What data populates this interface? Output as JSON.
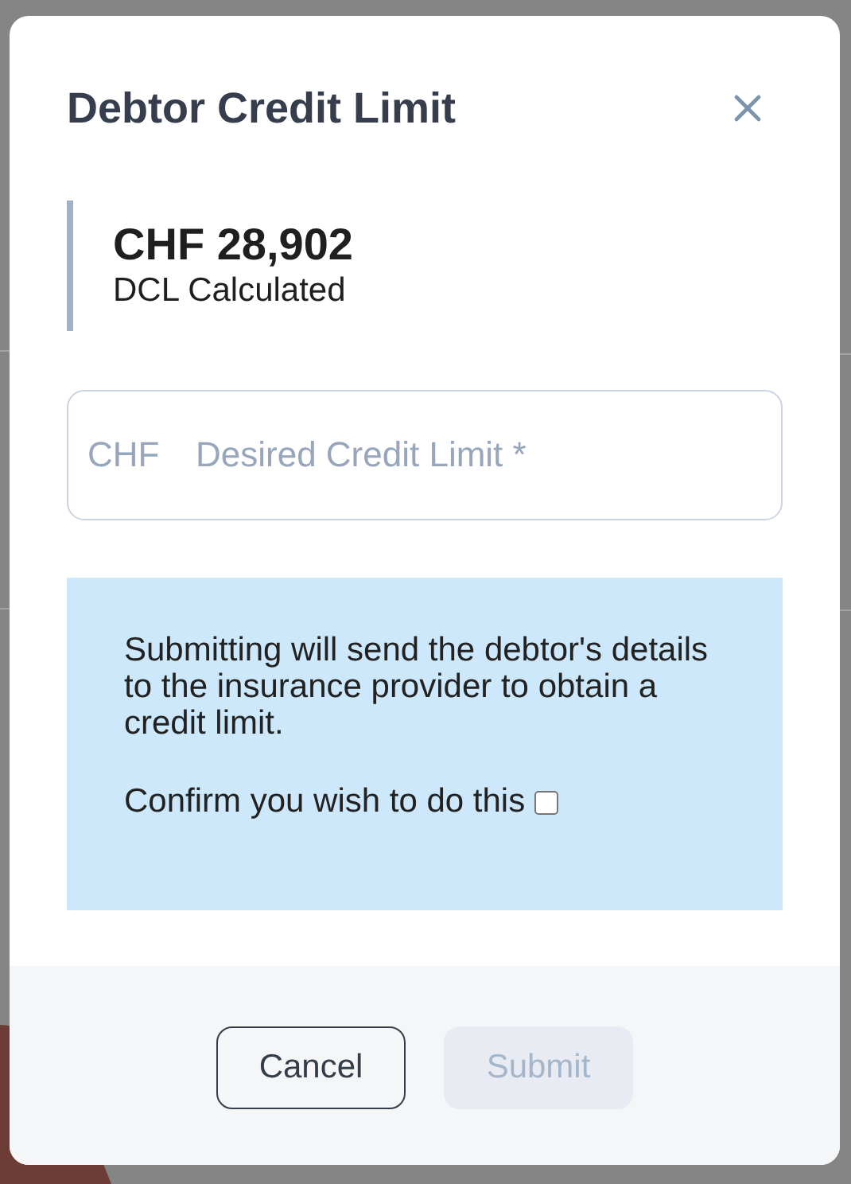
{
  "dialog": {
    "title": "Debtor Credit Limit"
  },
  "stat": {
    "value": "CHF 28,902",
    "label": "DCL Calculated"
  },
  "field": {
    "prefix": "CHF",
    "placeholder": "Desired Credit Limit *"
  },
  "notice": {
    "message": "Submitting will send the debtor's details to the insurance provider to obtain a credit limit.",
    "confirm_label": "Confirm you wish to do this",
    "checked": false
  },
  "buttons": [
    {
      "label": "Cancel",
      "kind": "secondary",
      "disabled": false
    },
    {
      "label": "Submit",
      "kind": "primary",
      "disabled": true
    }
  ]
}
